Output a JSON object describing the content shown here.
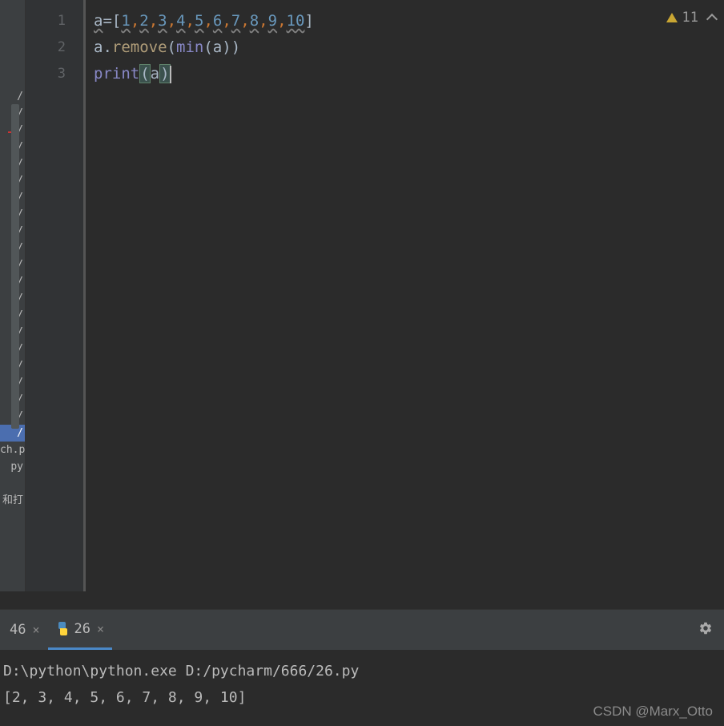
{
  "editor": {
    "lines": [
      "1",
      "2",
      "3"
    ],
    "code": {
      "line1": {
        "var": "a",
        "op": "=",
        "open": "[",
        "nums": [
          "1",
          "2",
          "3",
          "4",
          "5",
          "6",
          "7",
          "8",
          "9",
          "10"
        ],
        "close": "]"
      },
      "line2": {
        "obj": "a",
        "dot": ".",
        "method": "remove",
        "open": "(",
        "builtin": "min",
        "open2": "(",
        "arg": "a",
        "close2": ")",
        "close": ")"
      },
      "line3": {
        "builtin": "print",
        "open": "(",
        "arg": "a",
        "close": ")"
      }
    }
  },
  "inspection": {
    "warning_count": "11"
  },
  "filetree": {
    "items": [
      "/",
      "/",
      "/",
      "/",
      "/",
      "/",
      "/",
      "/",
      "/",
      "/",
      "/",
      "/",
      "/",
      "/",
      "/",
      "/",
      "/",
      "/",
      "/",
      "/",
      "/",
      "ch.p",
      "py",
      "",
      "和打"
    ],
    "selected_index": 20
  },
  "tabs": {
    "items": [
      {
        "label": "46",
        "active": false
      },
      {
        "label": "26",
        "active": true
      }
    ]
  },
  "console": {
    "command": "D:\\python\\python.exe D:/pycharm/666/26.py",
    "output": "[2, 3, 4, 5, 6, 7, 8, 9, 10]"
  },
  "watermark": "CSDN @Marx_Otto"
}
